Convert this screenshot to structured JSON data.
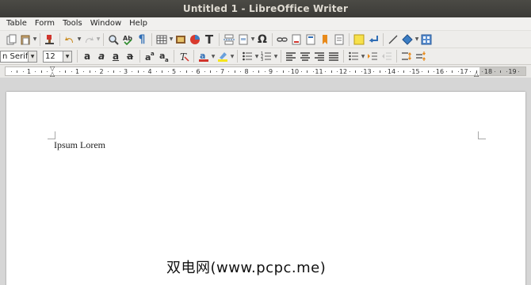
{
  "window": {
    "title": "Untitled 1 - LibreOffice Writer"
  },
  "menu": [
    "Table",
    "Form",
    "Tools",
    "Window",
    "Help"
  ],
  "toolbar_standard": {
    "icons": [
      "copy-icon",
      "paste-icon",
      "clone-formatting-icon",
      "undo-icon",
      "redo-icon",
      "find-replace-icon",
      "spelling-icon",
      "formatting-marks-icon",
      "insert-table-icon",
      "insert-image-icon",
      "insert-chart-icon",
      "insert-textbox-icon",
      "insert-page-break-icon",
      "insert-field-icon",
      "insert-special-character-icon",
      "insert-hyperlink-icon",
      "insert-footnote-icon",
      "insert-endnote-icon",
      "insert-bookmark-icon",
      "insert-cross-reference-icon",
      "insert-comment-icon",
      "track-changes-icon",
      "insert-line-icon",
      "basic-shapes-icon",
      "show-draw-functions-icon"
    ]
  },
  "toolbar_formatting": {
    "font_name": "n Serif",
    "font_size": "12",
    "icons": [
      "bold-icon",
      "italic-icon",
      "underline-icon",
      "strikethrough-icon",
      "superscript-icon",
      "subscript-icon",
      "clear-formatting-icon",
      "font-color-icon",
      "highlight-color-icon",
      "bullets-icon",
      "numbering-icon",
      "align-left-icon",
      "align-center-icon",
      "align-right-icon",
      "justify-icon",
      "line-spacing-icon",
      "increase-indent-icon",
      "decrease-indent-icon",
      "increase-paragraph-spacing-icon",
      "decrease-paragraph-spacing-icon"
    ]
  },
  "ruler": {
    "numbers": [
      "1",
      "1",
      "2",
      "3",
      "4",
      "5",
      "6",
      "7",
      "8",
      "9",
      "10",
      "11",
      "12",
      "13",
      "14",
      "15",
      "16",
      "17",
      "18",
      "19"
    ]
  },
  "document": {
    "text": "Ipsum Lorem"
  },
  "watermark": {
    "text": "双电网(www.pcpc.me)"
  },
  "colors": {
    "titlebar": "#3c3b37",
    "page": "#ffffff",
    "workspace": "#d6d6d6",
    "accent_blue": "#2f6db5"
  }
}
